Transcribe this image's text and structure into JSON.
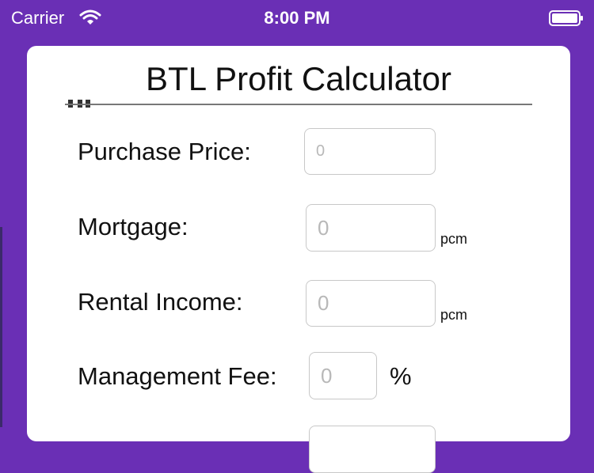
{
  "status_bar": {
    "carrier": "Carrier",
    "time": "8:00 PM",
    "icons": [
      "wifi-icon",
      "battery-icon"
    ]
  },
  "colors": {
    "background": "#6a2fb5",
    "card": "#ffffff",
    "text": "#111111",
    "placeholder": "#b8b8b8"
  },
  "calculator": {
    "title": "BTL Profit Calculator",
    "fields": [
      {
        "label": "Purchase Price:",
        "placeholder": "0",
        "unit": ""
      },
      {
        "label": "Mortgage:",
        "placeholder": "0",
        "unit": "pcm"
      },
      {
        "label": "Rental Income:",
        "placeholder": "0",
        "unit": "pcm"
      },
      {
        "label": "Management Fee:",
        "placeholder": "0",
        "unit": "%"
      }
    ]
  }
}
